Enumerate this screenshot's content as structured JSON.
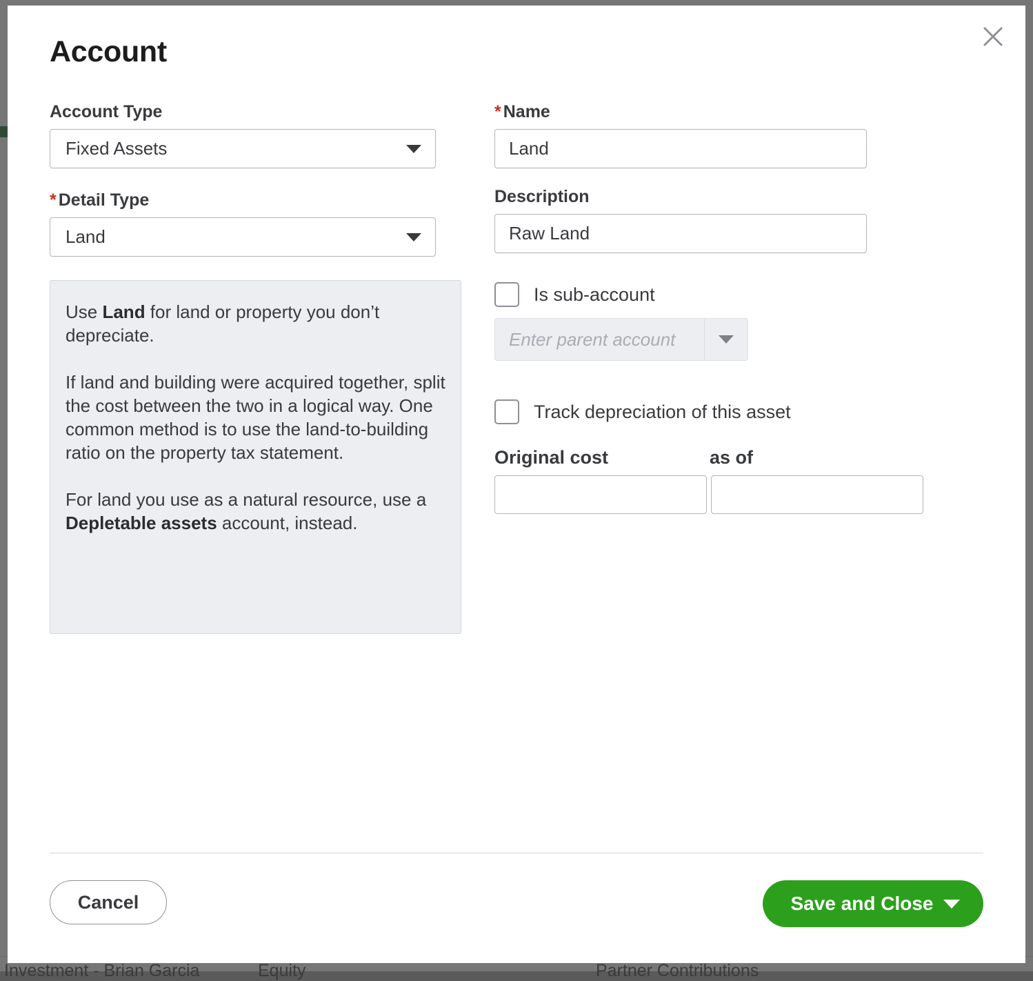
{
  "background": {
    "row": {
      "name": "Investment - Brian Garcia",
      "type": "Equity",
      "detail": "Partner Contributions"
    }
  },
  "modal": {
    "title": "Account",
    "close_icon": "close-icon",
    "left": {
      "account_type": {
        "label": "Account Type",
        "value": "Fixed Assets",
        "caret_icon": "chevron-down-icon"
      },
      "detail_type": {
        "required_mark": "*",
        "label": "Detail Type",
        "value": "Land",
        "caret_icon": "chevron-down-icon"
      },
      "info": {
        "paragraphs": [
          "Use Land for land or property you don’t depreciate.",
          "If land and building were acquired together, split the cost between the two in a logical way. One common method is to use the land-to-building ratio on the property tax statement.",
          "For land you use as a natural resource, use a Depletable assets account, instead."
        ],
        "p1_pre": "Use ",
        "p1_bold": "Land",
        "p1_post": " for land or property you don’t depreciate.",
        "p2": "If land and building were acquired together, split the cost between the two in a logical way. One common method is to use the land-to-building ratio on the property tax statement.",
        "p3_pre": "For land you use as a natural resource, use a ",
        "p3_bold": "Depletable assets",
        "p3_post": " account, instead."
      }
    },
    "right": {
      "name": {
        "required_mark": "*",
        "label": "Name",
        "value": "Land"
      },
      "description": {
        "label": "Description",
        "value": "Raw Land"
      },
      "is_sub_account": {
        "label": "Is sub-account",
        "checked": false
      },
      "parent_account": {
        "placeholder": "Enter parent account",
        "value": "",
        "disabled": true,
        "caret_icon": "chevron-down-icon"
      },
      "track_depreciation": {
        "label": "Track depreciation of this asset",
        "checked": false
      },
      "original_cost": {
        "label": "Original cost",
        "value": ""
      },
      "as_of": {
        "label": "as of",
        "value": ""
      }
    },
    "footer": {
      "cancel_label": "Cancel",
      "save_label": "Save and Close",
      "save_caret_icon": "chevron-down-icon"
    }
  },
  "colors": {
    "brand_green": "#2CA01C",
    "required_red": "#D52B1E",
    "text": "#393A3D",
    "info_bg": "#ECEEF1",
    "border": "#B1B5BC",
    "overlay": "#3C3C3C"
  }
}
